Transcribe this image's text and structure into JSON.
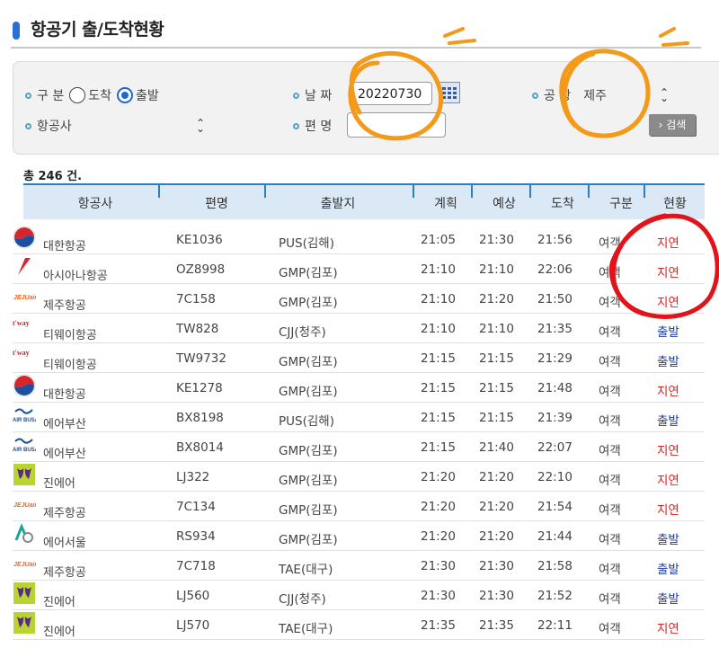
{
  "page": {
    "title": "항공기 출/도착현황"
  },
  "search": {
    "type_label": "구 분",
    "radio_arrival": "도착",
    "radio_departure": "출발",
    "selected": "출발",
    "date_label": "날 짜",
    "date_value": "20220730",
    "airport_label": "공 항",
    "airport_value": "제주",
    "airline_label": "항공사",
    "airline_value": "",
    "flight_label": "편 명",
    "flight_value": "",
    "search_button": "› 검색"
  },
  "results": {
    "total_text": "총 246 건."
  },
  "table": {
    "headers": [
      "항공사",
      "편명",
      "출발지",
      "계획",
      "예상",
      "도착",
      "구분",
      "현황"
    ],
    "rows": [
      {
        "airline": "대한항공",
        "logo": "korean-air-logo",
        "flight": "KE1036",
        "origin": "PUS(김해)",
        "plan": "21:05",
        "expected": "21:30",
        "arrival": "21:56",
        "type": "여객",
        "status": "지연"
      },
      {
        "airline": "아시아나항공",
        "logo": "asiana-logo",
        "flight": "OZ8998",
        "origin": "GMP(김포)",
        "plan": "21:10",
        "expected": "21:10",
        "arrival": "22:06",
        "type": "여객",
        "status": "지연"
      },
      {
        "airline": "제주항공",
        "logo": "jeju-air-logo",
        "flight": "7C158",
        "origin": "GMP(김포)",
        "plan": "21:10",
        "expected": "21:20",
        "arrival": "21:50",
        "type": "여객",
        "status": "지연"
      },
      {
        "airline": "티웨이항공",
        "logo": "tway-logo",
        "flight": "TW828",
        "origin": "CJJ(청주)",
        "plan": "21:10",
        "expected": "21:10",
        "arrival": "21:35",
        "type": "여객",
        "status": "출발"
      },
      {
        "airline": "티웨이항공",
        "logo": "tway-logo",
        "flight": "TW9732",
        "origin": "GMP(김포)",
        "plan": "21:15",
        "expected": "21:15",
        "arrival": "21:29",
        "type": "여객",
        "status": "출발"
      },
      {
        "airline": "대한항공",
        "logo": "korean-air-logo",
        "flight": "KE1278",
        "origin": "GMP(김포)",
        "plan": "21:15",
        "expected": "21:15",
        "arrival": "21:48",
        "type": "여객",
        "status": "지연"
      },
      {
        "airline": "에어부산",
        "logo": "air-busan-logo",
        "flight": "BX8198",
        "origin": "PUS(김해)",
        "plan": "21:15",
        "expected": "21:15",
        "arrival": "21:39",
        "type": "여객",
        "status": "출발"
      },
      {
        "airline": "에어부산",
        "logo": "air-busan-logo",
        "flight": "BX8014",
        "origin": "GMP(김포)",
        "plan": "21:15",
        "expected": "21:40",
        "arrival": "22:07",
        "type": "여객",
        "status": "지연"
      },
      {
        "airline": "진에어",
        "logo": "jin-air-logo",
        "flight": "LJ322",
        "origin": "GMP(김포)",
        "plan": "21:20",
        "expected": "21:20",
        "arrival": "22:10",
        "type": "여객",
        "status": "지연"
      },
      {
        "airline": "제주항공",
        "logo": "jeju-air-logo",
        "flight": "7C134",
        "origin": "GMP(김포)",
        "plan": "21:20",
        "expected": "21:20",
        "arrival": "21:54",
        "type": "여객",
        "status": "지연"
      },
      {
        "airline": "에어서울",
        "logo": "air-seoul-logo",
        "flight": "RS934",
        "origin": "GMP(김포)",
        "plan": "21:20",
        "expected": "21:20",
        "arrival": "21:44",
        "type": "여객",
        "status": "출발"
      },
      {
        "airline": "제주항공",
        "logo": "jeju-air-logo",
        "flight": "7C718",
        "origin": "TAE(대구)",
        "plan": "21:30",
        "expected": "21:30",
        "arrival": "21:58",
        "type": "여객",
        "status": "출발"
      },
      {
        "airline": "진에어",
        "logo": "jin-air-logo",
        "flight": "LJ560",
        "origin": "CJJ(청주)",
        "plan": "21:30",
        "expected": "21:30",
        "arrival": "21:52",
        "type": "여객",
        "status": "출발"
      },
      {
        "airline": "진에어",
        "logo": "jin-air-logo",
        "flight": "LJ570",
        "origin": "TAE(대구)",
        "plan": "21:35",
        "expected": "21:35",
        "arrival": "22:11",
        "type": "여객",
        "status": "지연"
      }
    ]
  },
  "logo_text": {
    "jeju-air-logo": "JEJUair",
    "tway-logo": "t'way",
    "air-busan-logo": "AIR BUSAN"
  },
  "colors": {
    "accent": "#2d7fc1",
    "status_delay": "#e0201b",
    "status_departure": "#1f3a9c",
    "annotation": "#f39a1b",
    "annotation_red": "#e2141b"
  }
}
